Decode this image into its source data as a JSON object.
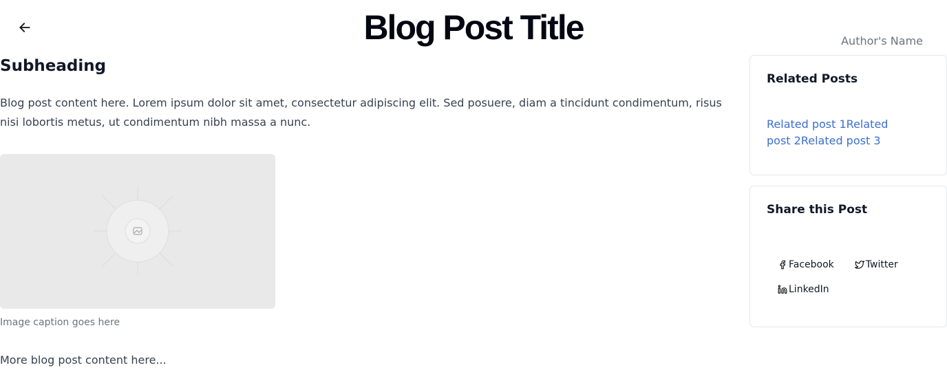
{
  "header": {
    "back_icon": "arrow-left-icon",
    "title": "Blog Post Title",
    "author": "Author's Name"
  },
  "post": {
    "subheading": "Subheading",
    "content": "Blog post content here. Lorem ipsum dolor sit amet, consectetur adipiscing elit. Sed posuere, diam a tincidunt condimentum, risus nisi lobortis metus, ut condimentum nibh massa a nunc.",
    "image_icon": "image-placeholder-icon",
    "caption": "Image caption goes here",
    "more": "More blog post content here..."
  },
  "related": {
    "title": "Related Posts",
    "links": [
      "Related post 1",
      "Related post 2",
      "Related post 3"
    ]
  },
  "share": {
    "title": "Share this Post",
    "facebook": "Facebook",
    "twitter": "Twitter",
    "linkedin": "LinkedIn"
  },
  "colors": {
    "link": "#3b6fd1",
    "muted": "#6b7280",
    "placeholder_bg": "#e9e9e9"
  }
}
